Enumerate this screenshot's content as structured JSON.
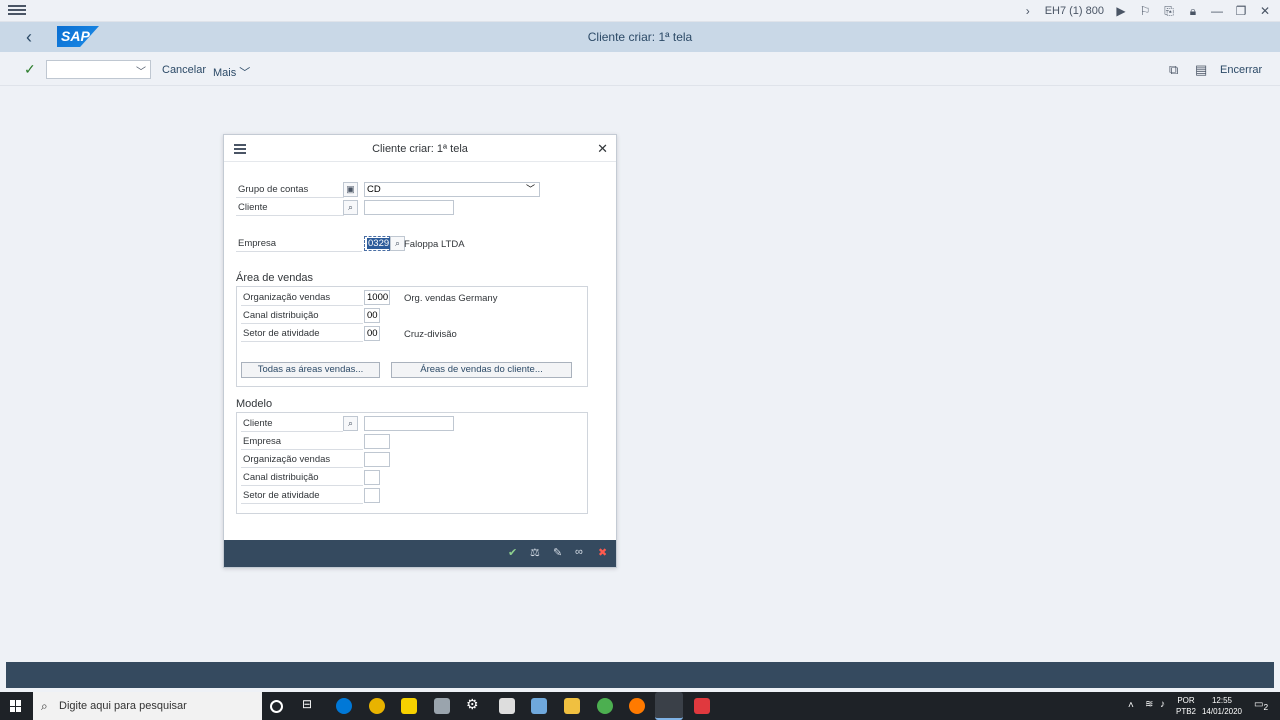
{
  "system_bar": {
    "system_id": "EH7 (1) 800"
  },
  "shell": {
    "logo": "SAP",
    "title": "Cliente criar: 1ª tela"
  },
  "toolbar": {
    "cancel_label": "Cancelar",
    "more_label": "Mais",
    "exit_label": "Encerrar"
  },
  "dialog": {
    "title": "Cliente criar: 1ª tela",
    "fields": {
      "account_group_label": "Grupo de contas",
      "account_group_value": "CD",
      "customer_label": "Cliente",
      "customer_value": "",
      "company_label": "Empresa",
      "company_value": "0329",
      "company_desc": "Faloppa LTDA"
    },
    "sales_area": {
      "heading": "Área de vendas",
      "sales_org_label": "Organização vendas",
      "sales_org_value": "1000",
      "sales_org_desc": "Org. vendas Germany",
      "dist_channel_label": "Canal distribuição",
      "dist_channel_value": "00",
      "division_label": "Setor de atividade",
      "division_value": "00",
      "division_desc": "Cruz-divisão",
      "all_areas_button": "Todas as áreas vendas...",
      "customer_areas_button": "Áreas de vendas do cliente..."
    },
    "template": {
      "heading": "Modelo",
      "customer_label": "Cliente",
      "company_label": "Empresa",
      "sales_org_label": "Organização vendas",
      "dist_channel_label": "Canal distribuição",
      "division_label": "Setor de atividade"
    }
  },
  "taskbar": {
    "search_placeholder": "Digite aqui para pesquisar",
    "lang_top": "POR",
    "lang_bottom": "PTB2",
    "time": "12:55",
    "date": "14/01/2020",
    "notifications": "2"
  },
  "colors": {
    "shell_header": "#c9d8e7",
    "footer_bar": "#354a5f",
    "accept_green": "#2b7d2b",
    "cancel_red": "#d0271d"
  }
}
